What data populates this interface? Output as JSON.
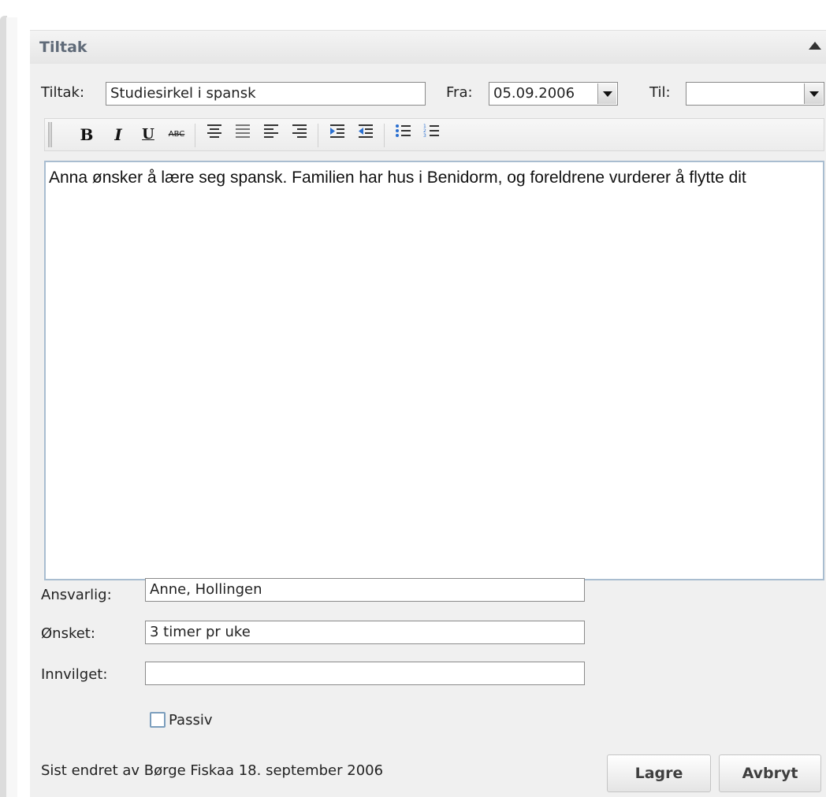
{
  "panel": {
    "title": "Tiltak"
  },
  "form": {
    "tiltak_label": "Tiltak:",
    "tiltak_value": "Studiesirkel i spansk",
    "fra_label": "Fra:",
    "fra_value": "05.09.2006",
    "til_label": "Til:",
    "til_value": ""
  },
  "toolbar": {
    "bold": "B",
    "italic": "I",
    "underline": "U",
    "strike": "ABC"
  },
  "editor": {
    "text": "Anna ønsker å lære seg spansk. Familien har hus i Benidorm, og foreldrene vurderer å flytte dit"
  },
  "details": {
    "ansvarlig_label": "Ansvarlig:",
    "ansvarlig_value": "Anne, Hollingen",
    "onsket_label": "Ønsket:",
    "onsket_value": "3 timer pr uke",
    "innvilget_label": "Innvilget:",
    "innvilget_value": "",
    "passiv_label": "Passiv",
    "passiv_checked": false
  },
  "footer": {
    "last_changed": "Sist endret av Børge Fiskaa 18. september 2006",
    "save_label": "Lagre",
    "cancel_label": "Avbryt"
  }
}
